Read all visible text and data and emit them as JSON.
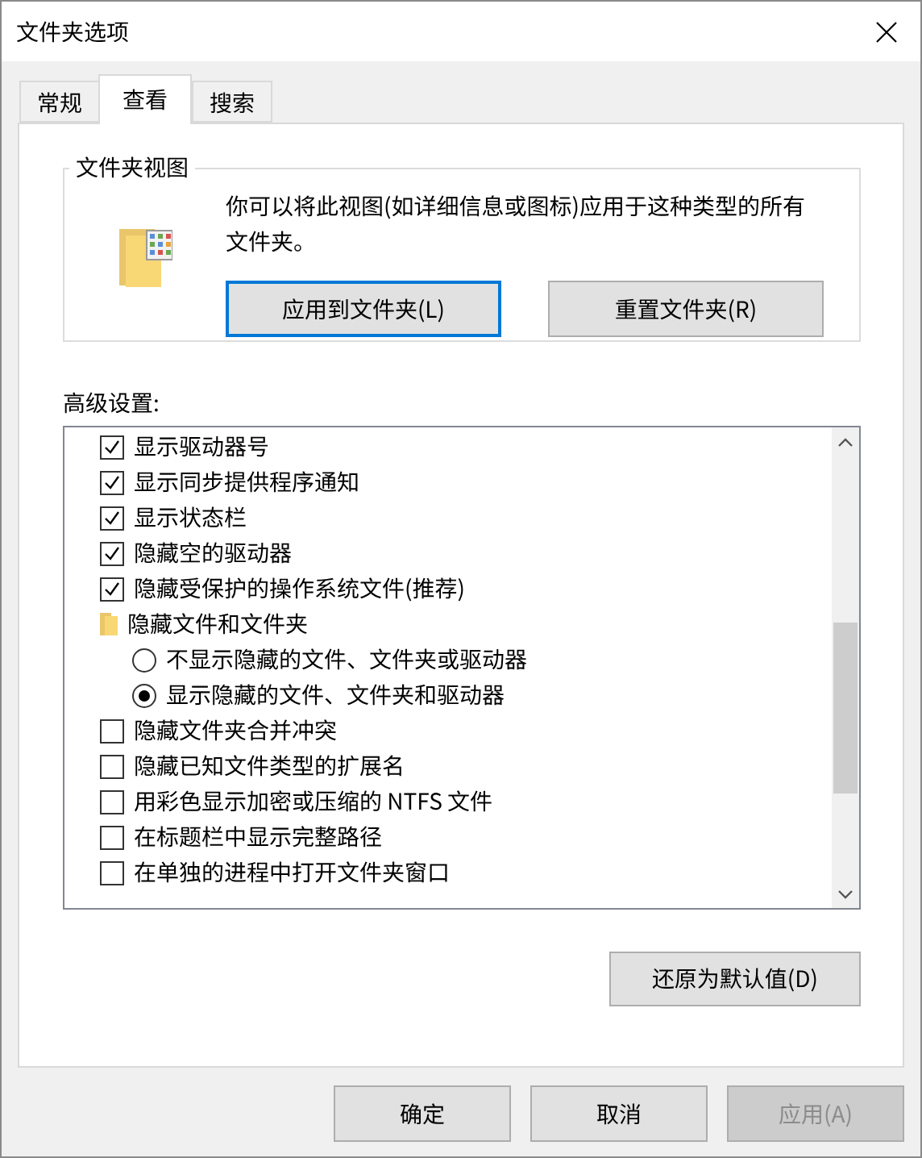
{
  "window": {
    "title": "文件夹选项"
  },
  "tabs": [
    {
      "label": "常规",
      "selected": false
    },
    {
      "label": "查看",
      "selected": true
    },
    {
      "label": "搜索",
      "selected": false
    }
  ],
  "folder_views": {
    "title": "文件夹视图",
    "description": "你可以将此视图(如详细信息或图标)应用于这种类型的所有文件夹。",
    "buttons": [
      {
        "label": "应用到文件夹(L)",
        "focused": true
      },
      {
        "label": "重置文件夹(R)",
        "focused": false
      }
    ]
  },
  "advanced": {
    "label": "高级设置:",
    "items": [
      {
        "kind": "checkbox",
        "label": "显示驱动器号",
        "checked": true
      },
      {
        "kind": "checkbox",
        "label": "显示同步提供程序通知",
        "checked": true
      },
      {
        "kind": "checkbox",
        "label": "显示状态栏",
        "checked": true
      },
      {
        "kind": "checkbox",
        "label": "隐藏空的驱动器",
        "checked": true
      },
      {
        "kind": "checkbox",
        "label": "隐藏受保护的操作系统文件(推荐)",
        "checked": true
      },
      {
        "kind": "folder",
        "label": "隐藏文件和文件夹",
        "children": [
          {
            "kind": "radio",
            "label": "不显示隐藏的文件、文件夹或驱动器",
            "selected": false
          },
          {
            "kind": "radio",
            "label": "显示隐藏的文件、文件夹和驱动器",
            "selected": true
          }
        ]
      },
      {
        "kind": "checkbox",
        "label": "隐藏文件夹合并冲突",
        "checked": false
      },
      {
        "kind": "checkbox",
        "label": "隐藏已知文件类型的扩展名",
        "checked": false
      },
      {
        "kind": "checkbox",
        "label": "用彩色显示加密或压缩的 NTFS 文件",
        "checked": false
      },
      {
        "kind": "checkbox",
        "label": "在标题栏中显示完整路径",
        "checked": false
      },
      {
        "kind": "checkbox",
        "label": "在单独的进程中打开文件夹窗口",
        "checked": false
      }
    ]
  },
  "restore_button": {
    "label": "还原为默认值(D)"
  },
  "buttons": [
    {
      "label": "确定",
      "disabled": false
    },
    {
      "label": "取消",
      "disabled": false
    },
    {
      "label": "应用(A)",
      "disabled": true
    }
  ]
}
